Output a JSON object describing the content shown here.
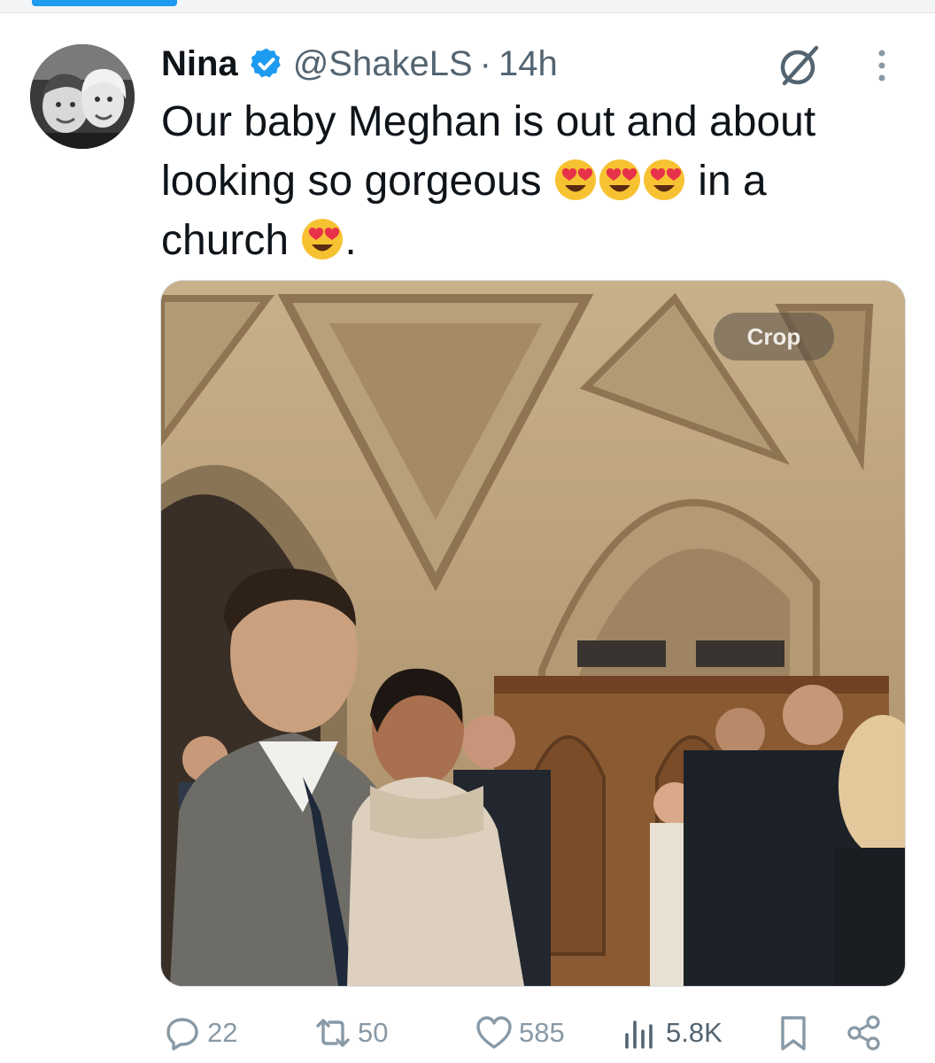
{
  "tweet": {
    "author_name": "Nina",
    "handle": "@ShakeLS",
    "separator": "·",
    "time": "14h",
    "text_1": "Our baby Meghan is out and about looking so gorgeous ",
    "text_2": " in a church ",
    "text_3": ".",
    "emoji_name": "smiling-face-with-heart-eyes",
    "media_overlay_label": "Crop"
  },
  "actions": {
    "replies": "22",
    "reposts": "50",
    "likes": "585",
    "views": "5.8K"
  },
  "colors": {
    "accent": "#1d9bf0",
    "text": "#0f1419",
    "secondary": "#536471",
    "icon": "#8899a6"
  }
}
